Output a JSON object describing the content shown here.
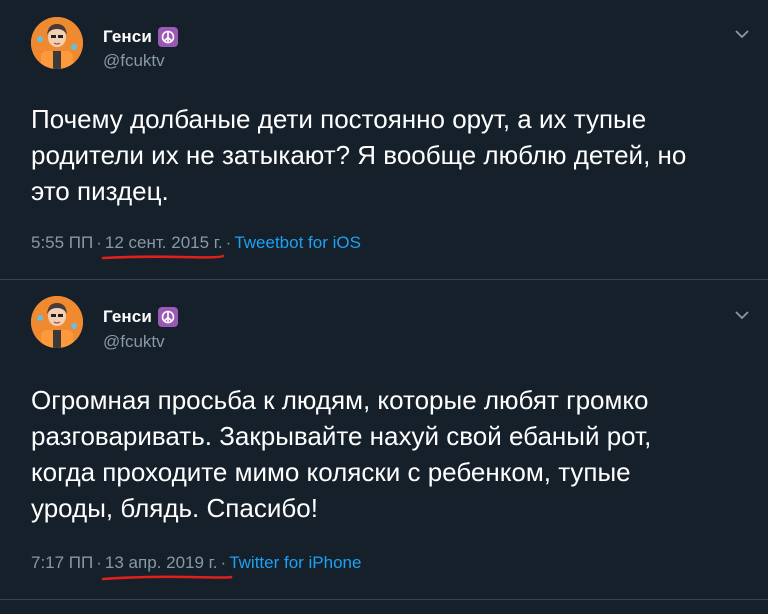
{
  "colors": {
    "background": "#15202b",
    "text_primary": "#ffffff",
    "text_secondary": "#8899a6",
    "link": "#1da1f2",
    "divider": "#38444d",
    "annotation_underline": "#e0201c",
    "badge": "#9b59b6"
  },
  "tweets": [
    {
      "display_name": "Генси",
      "handle": "@fcuktv",
      "badge_icon": "peace-symbol-icon",
      "text": "Почему долбаные дети постоянно орут, а их тупые\nродители их не затыкают? Я вообще люблю детей, но\nэто пиздец.",
      "time": "5:55 ПП",
      "separator": "·",
      "date": "12 сент. 2015 г.",
      "source": "Tweetbot for iOS"
    },
    {
      "display_name": "Генси",
      "handle": "@fcuktv",
      "badge_icon": "peace-symbol-icon",
      "text": "Огромная просьба к людям, которые любят громко\nразговаривать. Закрывайте нахуй свой ебаный рот,\nкогда проходите мимо коляски с ребенком, тупые\nуроды, блядь. Спасибо!",
      "time": "7:17 ПП",
      "separator": "·",
      "date": "13 апр. 2019 г.",
      "source": "Twitter for iPhone"
    }
  ]
}
